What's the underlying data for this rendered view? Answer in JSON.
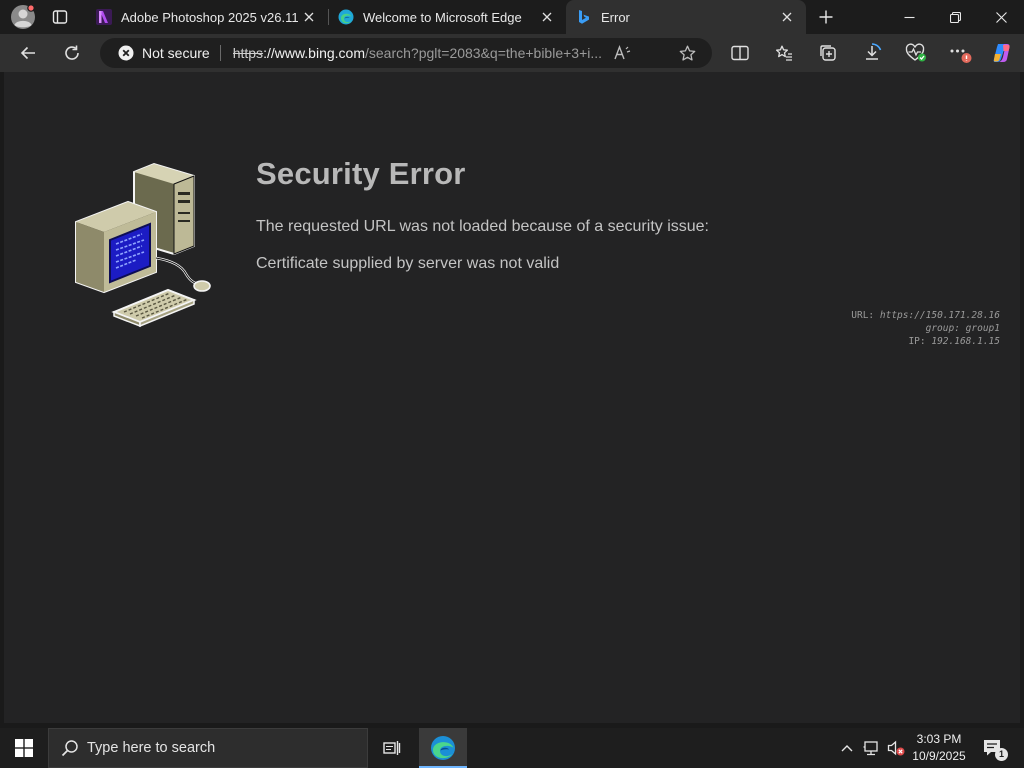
{
  "browser": {
    "tabs": [
      {
        "title": "Adobe Photoshop 2025 v26.11.0.7",
        "favicon": "fmhy-favicon",
        "active": false
      },
      {
        "title": "Welcome to Microsoft Edge",
        "favicon": "edge-favicon",
        "active": false
      },
      {
        "title": "Error",
        "favicon": "bing-favicon",
        "active": true
      }
    ],
    "new_tab_icon": "plus-icon"
  },
  "toolbar": {
    "security_label": "Not secure",
    "url_scheme": "https",
    "url_host": "://www.bing.com",
    "url_path": "/search?pglt=2083&q=the+bible+3+i..."
  },
  "page": {
    "title": "Security Error",
    "line1": "The requested URL was not loaded because of a security issue:",
    "line2": "Certificate supplied by server was not valid",
    "details": {
      "url_label": "URL:",
      "url_value": "https://150.171.28.16",
      "group_label": "group:",
      "group_value": "group1",
      "ip_label": "IP:",
      "ip_value": "192.168.1.15"
    }
  },
  "taskbar": {
    "search_placeholder": "Type here to search",
    "time": "3:03 PM",
    "date": "10/9/2025",
    "notification_count": "1"
  },
  "colors": {
    "page_bg": "#232324",
    "toolbar_bg": "#303030",
    "titlebar_bg": "#1c1c1c",
    "accent": "#6fb6ff"
  }
}
